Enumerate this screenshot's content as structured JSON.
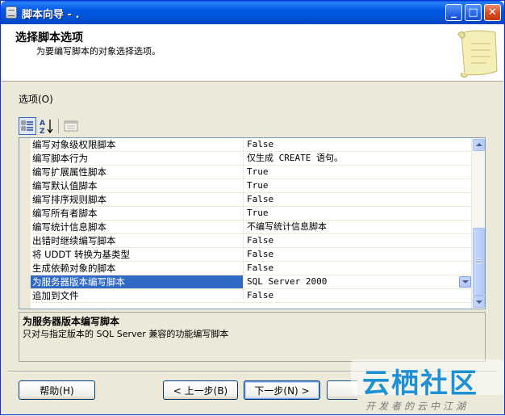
{
  "window": {
    "title": "脚本向导 - .",
    "minimize_label": "_",
    "maximize_label": "□",
    "close_label": "✕"
  },
  "header": {
    "title": "选择脚本选项",
    "subtitle": "为要编写脚本的对象选择选项。"
  },
  "options": {
    "label": "选项(O)"
  },
  "toolbar": {
    "alpha_label": "A↓"
  },
  "grid": {
    "rows": [
      {
        "name": "编写对象级权限脚本",
        "value": "False"
      },
      {
        "name": "编写脚本行为",
        "value": "仅生成 CREATE 语句。"
      },
      {
        "name": "编写扩展属性脚本",
        "value": "True"
      },
      {
        "name": "编写默认值脚本",
        "value": "True"
      },
      {
        "name": "编写排序规则脚本",
        "value": "False"
      },
      {
        "name": "编写所有者脚本",
        "value": "True"
      },
      {
        "name": "编写统计信息脚本",
        "value": "不编写统计信息脚本"
      },
      {
        "name": "出错时继续编写脚本",
        "value": "False"
      },
      {
        "name": "将 UDDT 转换为基类型",
        "value": "False"
      },
      {
        "name": "生成依赖对象的脚本",
        "value": "False"
      },
      {
        "name": "为服务器版本编写脚本",
        "value": "SQL Server 2000"
      },
      {
        "name": "追加到文件",
        "value": "False"
      }
    ],
    "selected_index": 10
  },
  "description": {
    "title": "为服务器版本编写脚本",
    "text": "只对与指定版本的 SQL Server 兼容的功能编写脚本"
  },
  "buttons": {
    "help": "帮助(H)",
    "back": "< 上一步(B)",
    "next": "下一步(N) >"
  },
  "watermark": {
    "logo": "云栖社区",
    "tagline": "开发者的云中江湖"
  },
  "colors": {
    "titlebar": "#0058e6",
    "selection": "#316ac5",
    "dialog_bg": "#ece9d8",
    "watermark": "#1e90d4"
  }
}
